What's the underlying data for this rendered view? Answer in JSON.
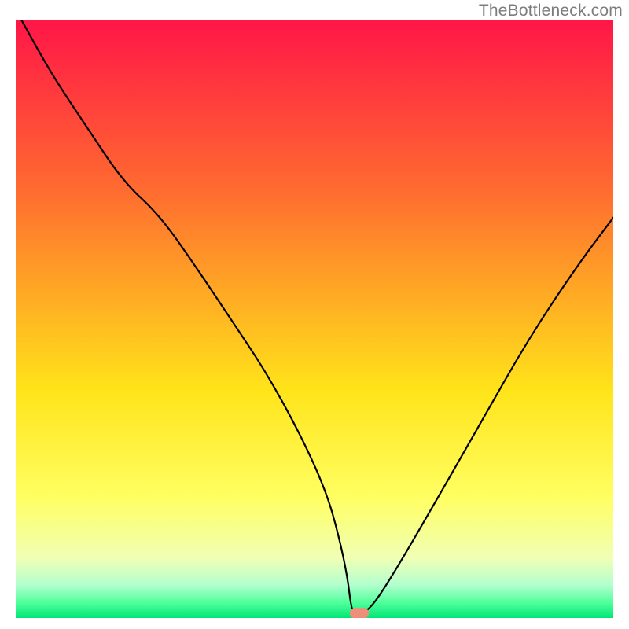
{
  "watermark": "TheBottleneck.com",
  "chart_data": {
    "type": "line",
    "title": "",
    "xlabel": "",
    "ylabel": "",
    "xlim": [
      0,
      100
    ],
    "ylim": [
      0,
      100
    ],
    "grid": false,
    "legend": null,
    "background_gradient_top_to_bottom": [
      "#ff1647",
      "#ff6a30",
      "#ffe41a",
      "#ffff63",
      "#f0ffb5",
      "#b2ffce",
      "#4fff9a",
      "#00e676"
    ],
    "series": [
      {
        "name": "bottleneck-curve",
        "color": "#000000",
        "x": [
          1,
          6,
          12,
          18,
          24,
          30,
          36,
          42,
          48,
          52,
          54,
          55.5,
          56.2,
          57,
          59,
          63,
          70,
          78,
          86,
          94,
          100
        ],
        "y": [
          100,
          91,
          82,
          73,
          67.5,
          59,
          50,
          41,
          30,
          21,
          14,
          7,
          1.2,
          1.0,
          1.0,
          7,
          19,
          33,
          47,
          59,
          67
        ]
      }
    ],
    "marker": {
      "name": "optimal-point",
      "shape": "rounded-rect",
      "color": "#ee9079",
      "x": 57.5,
      "y": 0.8,
      "w": 3.2,
      "h": 1.8
    }
  }
}
